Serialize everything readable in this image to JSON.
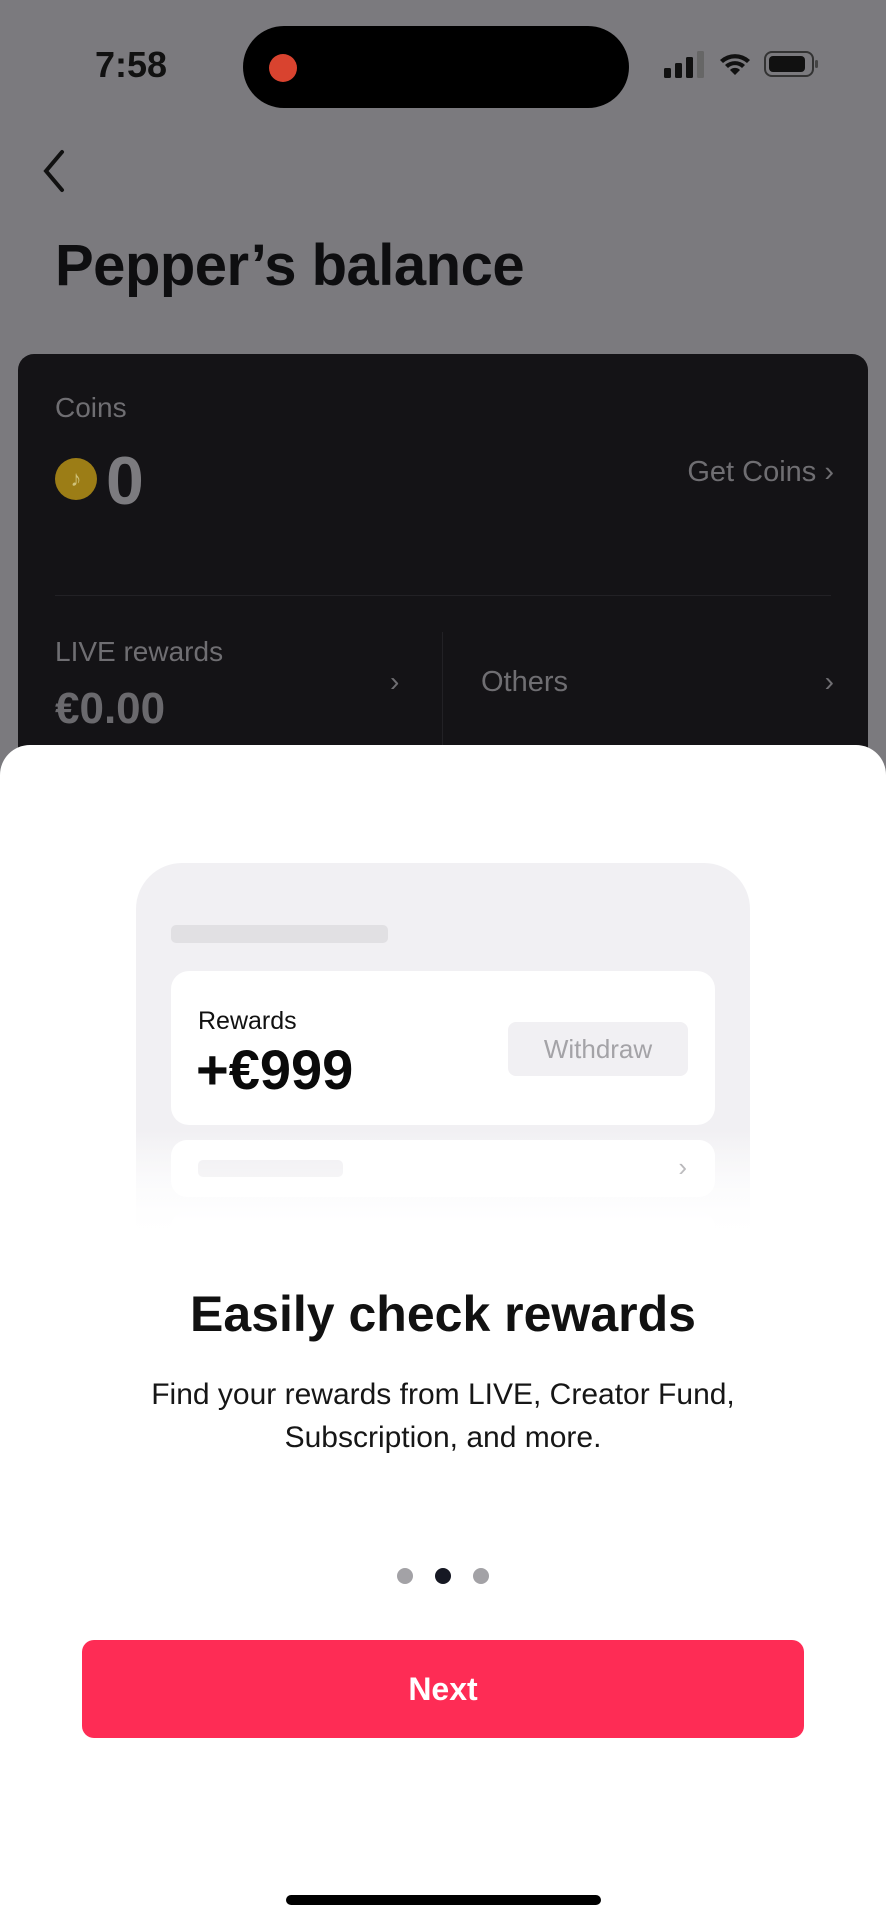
{
  "status_bar": {
    "time": "7:58"
  },
  "header": {
    "title": "Pepper’s balance"
  },
  "balance_card": {
    "coins_label": "Coins",
    "coins_value": "0",
    "get_coins": "Get Coins ›",
    "live_rewards_label": "LIVE rewards",
    "live_rewards_value": "€0.00",
    "chevron": "›",
    "others_label": "Others"
  },
  "onboarding": {
    "illustration": {
      "rewards_label": "Rewards",
      "rewards_value": "+€999",
      "withdraw": "Withdraw",
      "chevron": "›"
    },
    "heading": "Easily check rewards",
    "description": "Find your rewards from LIVE, Creator Fund, Subscription, and more.",
    "pagination": {
      "current": 2,
      "total": 3
    },
    "next_label": "Next"
  },
  "colors": {
    "accent": "#fe2c55",
    "coin": "#9c7d16",
    "recording": "#d9432f"
  }
}
